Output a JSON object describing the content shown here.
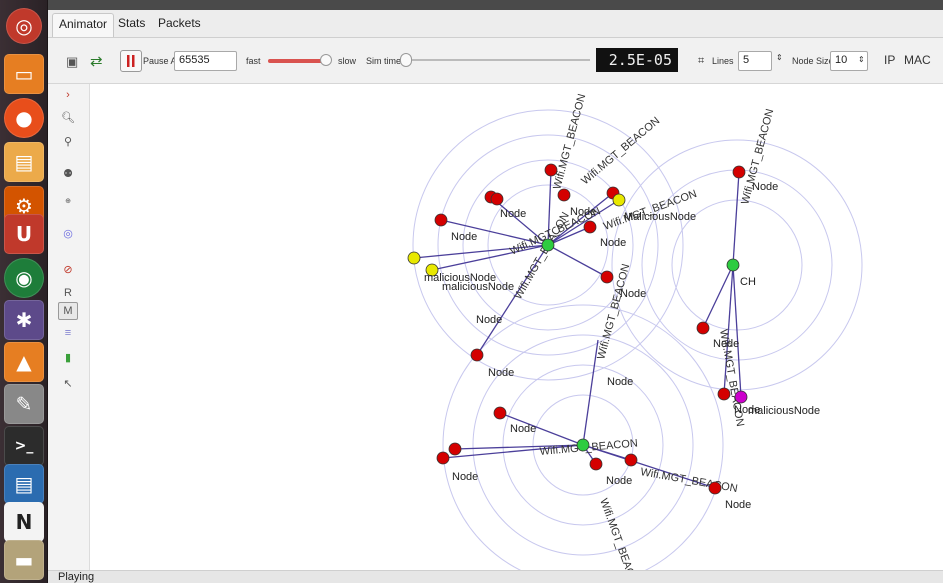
{
  "tabs": [
    "Animator",
    "Stats",
    "Packets"
  ],
  "toolbar": {
    "pause_at_label": "Pause At",
    "pause_at_value": "65535",
    "fast_label": "fast",
    "slow_label": "slow",
    "sim_time_label": "Sim time",
    "time_display": "2.5E-05",
    "lines_label": "Lines",
    "lines_value": "5",
    "node_size_label": "Node Size",
    "node_size_value": "10",
    "ip_label": "IP",
    "mac_label": "MAC"
  },
  "sidebar": {
    "r_label": "R",
    "m_label": "M"
  },
  "status": {
    "text": "Playing"
  },
  "network": {
    "link_color": "#4b3f9a",
    "node_color": "#d40000",
    "malicious_color": "#e8e800",
    "ch_color": "#2ecc40",
    "magenta_color": "#cc00cc",
    "labels": {
      "node": "Node",
      "malicious": "maliciousNode",
      "malicious_cap": "MaliciousNode",
      "beacon": "Wifi.MGT_BEACON",
      "ch": "CH"
    }
  },
  "colors": {
    "launcher_bg": "#2f2528",
    "time_display_bg": "#111111",
    "time_display_fg": "#f0f0f0",
    "speed_slider": "#d9534f"
  }
}
